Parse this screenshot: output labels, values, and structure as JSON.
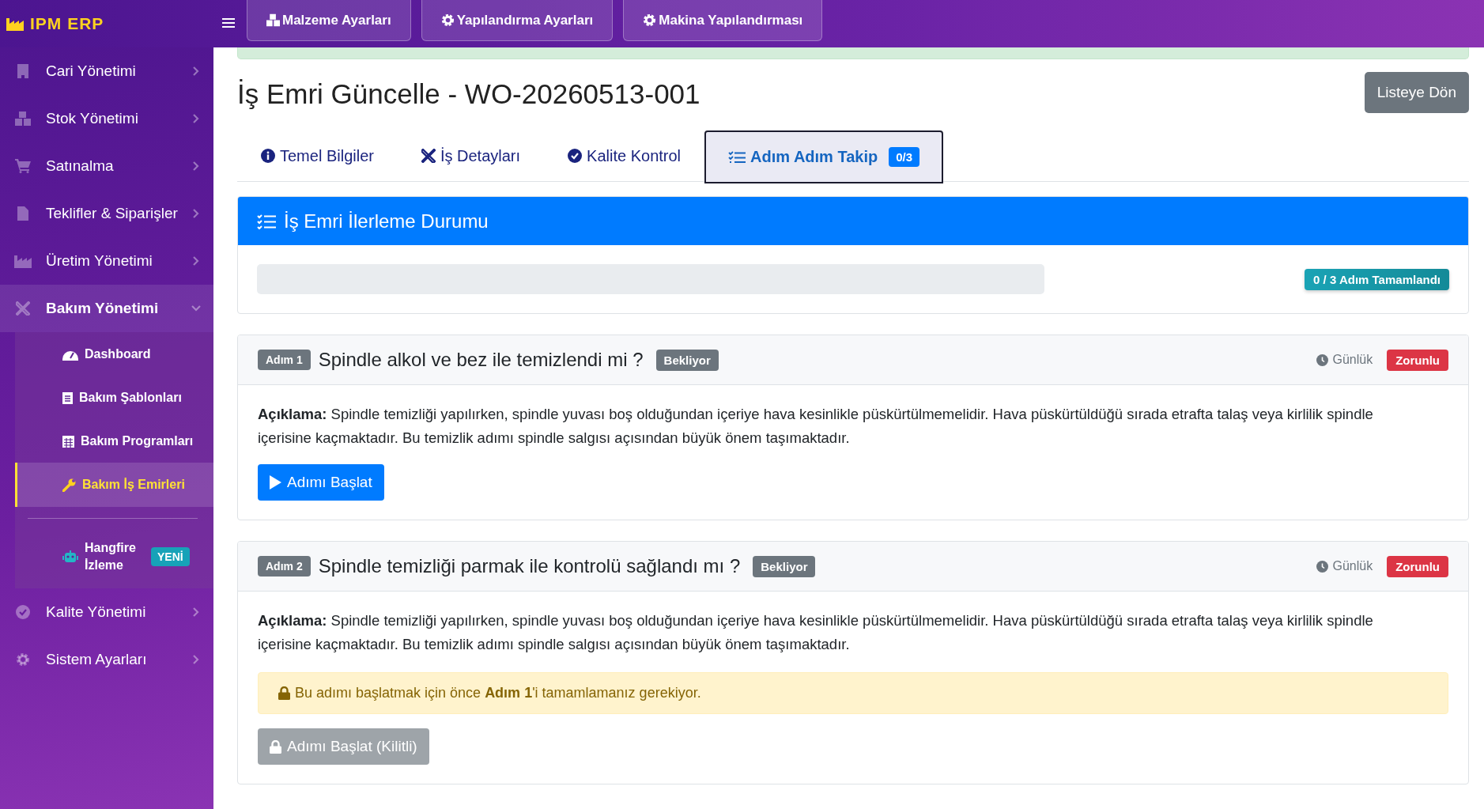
{
  "brand": {
    "name": "IPM ERP"
  },
  "top_nav": [
    {
      "label": "Malzeme Ayarları"
    },
    {
      "label": "Yapılandırma Ayarları"
    },
    {
      "label": "Makina Yapılandırması"
    }
  ],
  "sidebar": {
    "items": [
      {
        "label": "Cari Yönetimi",
        "expanded": false
      },
      {
        "label": "Stok Yönetimi",
        "expanded": false
      },
      {
        "label": "Satınalma",
        "expanded": false
      },
      {
        "label": "Teklifler & Siparişler",
        "expanded": false
      },
      {
        "label": "Üretim Yönetimi",
        "expanded": false
      },
      {
        "label": "Bakım Yönetimi",
        "expanded": true,
        "children": [
          {
            "label": "Dashboard",
            "selected": false
          },
          {
            "label": "Bakım Şablonları",
            "selected": false
          },
          {
            "label": "Bakım Programları",
            "selected": false
          },
          {
            "label": "Bakım İş Emirleri",
            "selected": true
          },
          {
            "label": "Hangfire İzleme",
            "selected": false,
            "badge": "YENİ"
          }
        ]
      },
      {
        "label": "Kalite Yönetimi",
        "expanded": false
      },
      {
        "label": "Sistem Ayarları",
        "expanded": false
      }
    ]
  },
  "page": {
    "title": "İş Emri Güncelle - WO-20260513-001",
    "back_button": "Listeye Dön"
  },
  "tabs": [
    {
      "label": "Temel Bilgiler",
      "selected": false
    },
    {
      "label": "İş Detayları",
      "selected": false
    },
    {
      "label": "Kalite Kontrol",
      "selected": false
    },
    {
      "label": "Adım Adım Takip",
      "selected": true,
      "badge": "0/3"
    }
  ],
  "progress": {
    "title": "İş Emri İlerleme Durumu",
    "level": 0,
    "badge": "0 / 3 Adım Tamamlandı"
  },
  "steps": [
    {
      "step_label": "Adım 1",
      "title": "Spindle alkol ve bez ile temizlendi mi ?",
      "status": "Bekliyor",
      "frequency": "Günlük",
      "requirement": "Zorunlu",
      "description": "**Açıklama:** Spindle temizliği yapılırken, spindle yuvası boş olduğundan içeriye hava kesinlikle püskürtülmemelidir. Hava püskürtüldüğü sırada etrafta talaş veya kirlilik spindle içerisine kaçmaktadır. Bu temizlik adımı spindle salgısı açısından büyük önem taşımaktadır.",
      "locked": false,
      "button": "Adımı Başlat"
    },
    {
      "step_label": "Adım 2",
      "title": "Spindle temizliği parmak ile kontrolü sağlandı mı ?",
      "status": "Bekliyor",
      "frequency": "Günlük",
      "requirement": "Zorunlu",
      "description": "**Açıklama:** Spindle temizliği yapılırken, spindle yuvası boş olduğundan içeriye hava kesinlikle püskürtülmemelidir. Hava püskürtüldüğü sırada etrafta talaş veya kirlilik spindle içerisine kaçmaktadır. Bu temizlik adımı spindle salgısı açısından büyük önem taşımaktadır.",
      "locked": true,
      "notice": "Bu adımı başlatmak için önce **Adım 1**'i tamamlamanız gerekiyor.",
      "button": "Adımı Başlat (Kilitli)"
    }
  ]
}
